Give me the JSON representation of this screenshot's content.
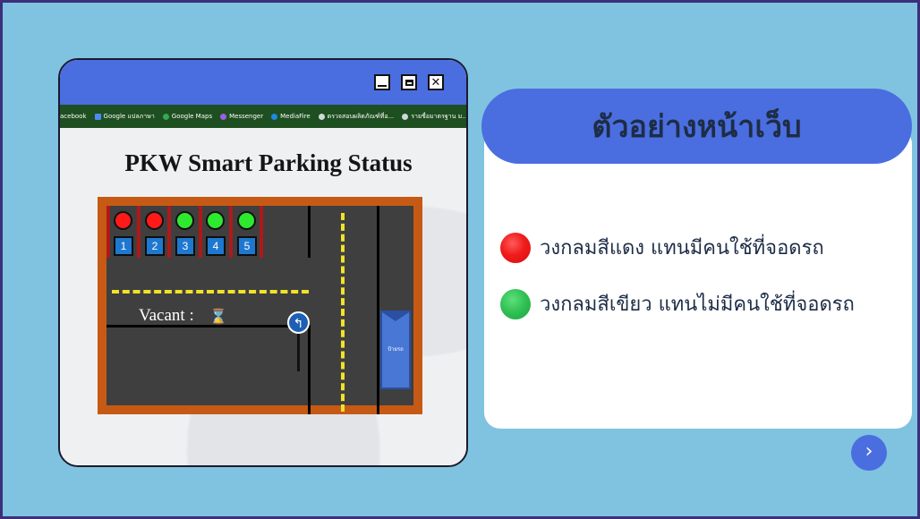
{
  "window": {
    "controls": {
      "minimize": "",
      "maximize": "",
      "close": "✕"
    },
    "bookmarks": [
      "acebook",
      "Google แปลภาษา",
      "Google Maps",
      "Messenger",
      "MediaFire",
      "ตรวจสอบผลิตภัณฑ์ที่อ...",
      "รายชื่อมาตรฐาน ม..."
    ],
    "page": {
      "title": "PKW Smart Parking Status",
      "spots": [
        {
          "number": "1",
          "status": "occupied"
        },
        {
          "number": "2",
          "status": "occupied"
        },
        {
          "number": "3",
          "status": "vacant"
        },
        {
          "number": "4",
          "status": "vacant"
        },
        {
          "number": "5",
          "status": "vacant"
        }
      ],
      "vacant_label": "Vacant :",
      "hourglass_icon": "⌛",
      "sign_icon": "↰",
      "bus_label": "ป้ายรถ"
    }
  },
  "legend": {
    "title": "ตัวอย่างหน้าเว็บ",
    "items": [
      {
        "color": "red",
        "text": "วงกลมสีแดง แทนมีคนใช้ที่จอดรถ"
      },
      {
        "color": "green",
        "text": "วงกลมสีเขียว แทนไม่มีคนใช้ที่จอดรถ"
      }
    ]
  },
  "next_icon": "›",
  "colors": {
    "background": "#7fc3e0",
    "accent": "#4a6ee0",
    "occupied": "#ff1a1a",
    "vacant": "#2eea2e"
  }
}
